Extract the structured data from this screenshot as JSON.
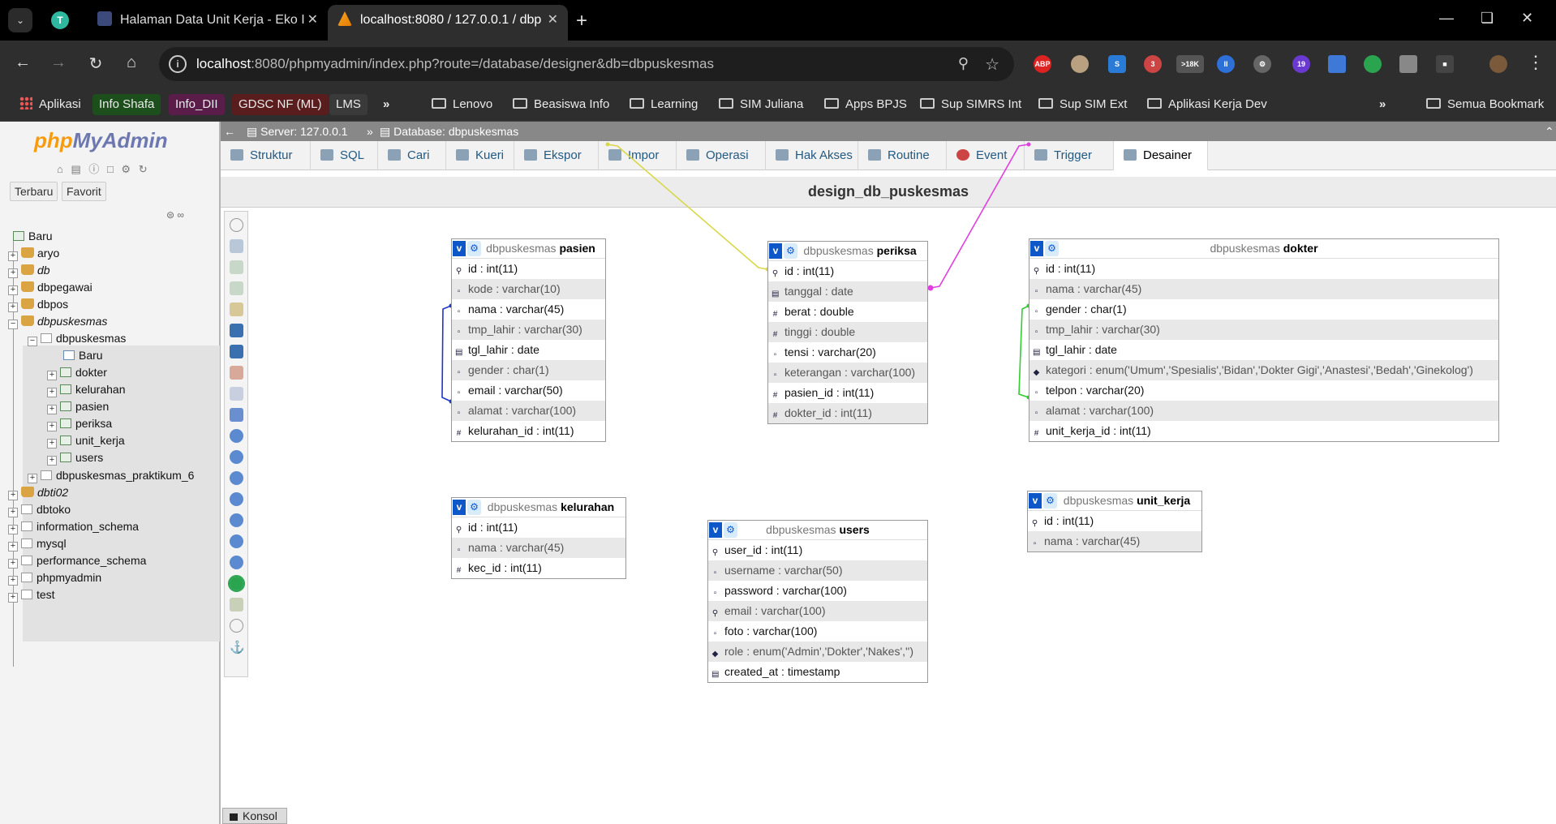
{
  "browser": {
    "tabs": [
      {
        "title": "Halaman Data Unit Kerja - Eko I"
      },
      {
        "title": "localhost:8080 / 127.0.0.1 / dbp"
      }
    ],
    "url_host": "localhost",
    "url_rest": ":8080/phpmyadmin/index.php?route=/database/designer&db=dbpuskesmas",
    "bookmarks": [
      "Aplikasi",
      "Info Shafa",
      "Info_DII",
      "GDSC NF (ML)",
      "LMS",
      "Lenovo",
      "Beasiswa Info",
      "Learning",
      "SIM Juliana",
      "Apps BPJS",
      "Sup SIMRS Int",
      "Sup SIM Ext",
      "Aplikasi Kerja Dev",
      "Semua Bookmark"
    ],
    "extension_badges": [
      "ABP",
      "3",
      ">18K",
      "19"
    ],
    "profile_initial": "T"
  },
  "pma": {
    "logo_php": "php",
    "logo_myadmin": "MyAdmin",
    "nav_tabs": [
      "Terbaru",
      "Favorit"
    ],
    "tree": {
      "root_new": "Baru",
      "databases_top": [
        "aryo",
        "db",
        "dbpegawai",
        "dbpos",
        "dbpuskesmas"
      ],
      "dbpuskesmas_child": "dbpuskesmas",
      "dbpuskesmas_new": "Baru",
      "tables": [
        "dokter",
        "kelurahan",
        "pasien",
        "periksa",
        "unit_kerja",
        "users"
      ],
      "praktikum": "dbpuskesmas_praktikum_6",
      "databases_bottom": [
        "dbti02",
        "dbtoko",
        "information_schema",
        "mysql",
        "performance_schema",
        "phpmyadmin",
        "test"
      ]
    },
    "breadcrumb": {
      "server": "Server: 127.0.0.1",
      "database": "Database: dbpuskesmas"
    },
    "menu": [
      "Struktur",
      "SQL",
      "Cari",
      "Kueri",
      "Ekspor",
      "Impor",
      "Operasi",
      "Hak Akses",
      "Routine",
      "Event",
      "Trigger",
      "Desainer"
    ],
    "designer_title": "design_db_puskesmas",
    "console_label": "Konsol"
  },
  "designer": {
    "db_name": "dbpuskesmas",
    "tables": {
      "pasien": {
        "name": "pasien",
        "columns": [
          "id : int(11)",
          "kode : varchar(10)",
          "nama : varchar(45)",
          "tmp_lahir : varchar(30)",
          "tgl_lahir : date",
          "gender : char(1)",
          "email : varchar(50)",
          "alamat : varchar(100)",
          "kelurahan_id : int(11)"
        ]
      },
      "periksa": {
        "name": "periksa",
        "columns": [
          "id : int(11)",
          "tanggal : date",
          "berat : double",
          "tinggi : double",
          "tensi : varchar(20)",
          "keterangan : varchar(100)",
          "pasien_id : int(11)",
          "dokter_id : int(11)"
        ]
      },
      "dokter": {
        "name": "dokter",
        "columns": [
          "id : int(11)",
          "nama : varchar(45)",
          "gender : char(1)",
          "tmp_lahir : varchar(30)",
          "tgl_lahir : date",
          "kategori : enum('Umum','Spesialis','Bidan','Dokter Gigi','Anastesi','Bedah','Ginekolog')",
          "telpon : varchar(20)",
          "alamat : varchar(100)",
          "unit_kerja_id : int(11)"
        ]
      },
      "kelurahan": {
        "name": "kelurahan",
        "columns": [
          "id : int(11)",
          "nama : varchar(45)",
          "kec_id : int(11)"
        ]
      },
      "users": {
        "name": "users",
        "columns": [
          "user_id : int(11)",
          "username : varchar(50)",
          "password : varchar(100)",
          "email : varchar(100)",
          "foto : varchar(100)",
          "role : enum('Admin','Dokter','Nakes','')",
          "created_at : timestamp"
        ]
      },
      "unit_kerja": {
        "name": "unit_kerja",
        "columns": [
          "id : int(11)",
          "nama : varchar(45)"
        ]
      }
    },
    "relation_colors": {
      "pasien_periksa": "#d8d84a",
      "dokter_periksa": "#e040e0",
      "kelurahan_pasien": "#2233cc",
      "unit_kerja_dokter": "#33cc33"
    }
  }
}
